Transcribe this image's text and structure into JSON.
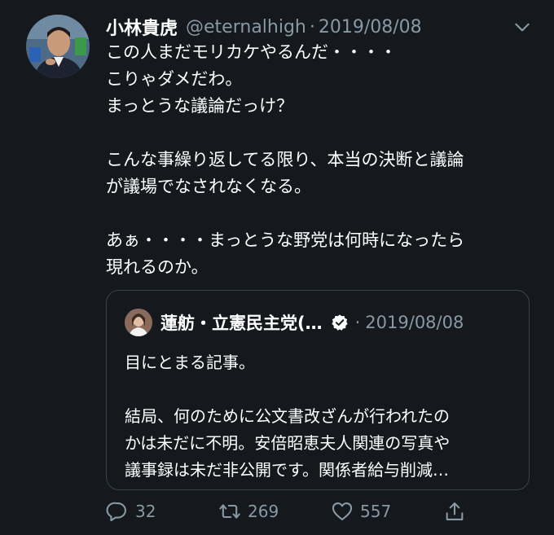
{
  "tweet": {
    "author_name": "小林貴虎",
    "handle": "@eternalhigh",
    "separator": "·",
    "date": "2019/08/08",
    "lines_block1": [
      "この人まだモリカケやるんだ・・・・",
      "こりゃダメだわ。",
      "まっとうな議論だっけ？"
    ],
    "lines_block2": [
      "こんな事繰り返してる限り、本当の決断と議論",
      "が議場でなされなくなる。"
    ],
    "lines_block3": [
      "あぁ・・・・まっとうな野党は何時になったら",
      "現れるのか。"
    ]
  },
  "quoted": {
    "author_name": "蓮舫・立憲民主党(…",
    "separator": "·",
    "date": "2019/08/08",
    "lines_block1": [
      "目にとまる記事。"
    ],
    "lines_block2": [
      "結局、何のために公文書改ざんが行われたの",
      "かは未だに不明。安倍昭恵夫人関連の写真や",
      "議事録は未だ非公開です。関係者給与削減…"
    ]
  },
  "actions": {
    "replies": "32",
    "retweets": "269",
    "likes": "557"
  },
  "icons": {
    "reply": "reply-icon",
    "retweet": "retweet-icon",
    "like": "heart-icon",
    "share": "share-icon",
    "more": "chevron-down-icon",
    "verified": "verified-icon"
  },
  "colors": {
    "background": "#15181c",
    "text": "#ffffff",
    "muted": "#8899a6",
    "border": "#38444d"
  }
}
